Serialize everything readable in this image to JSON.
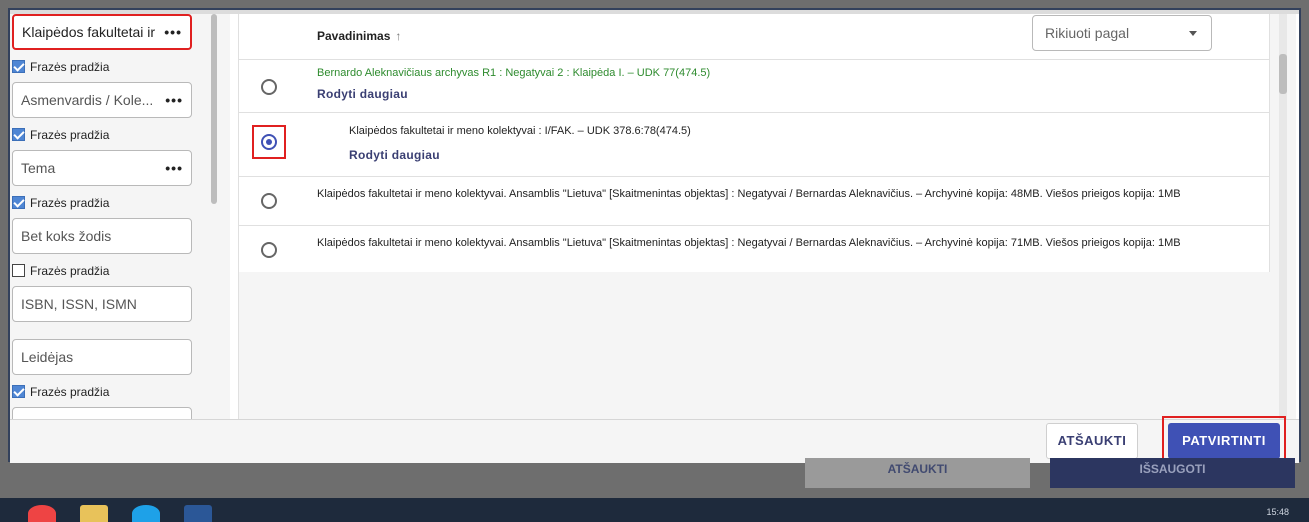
{
  "filters": [
    {
      "label": "Klaipėdos fakultetai ir",
      "active": true,
      "phrase_start": true
    },
    {
      "label": "Asmenvardis / Kole...",
      "phrase_start": true
    },
    {
      "label": "Tema",
      "phrase_start": true
    },
    {
      "label": "Bet koks žodis",
      "phrase_start": false
    },
    {
      "label": "ISBN, ISSN, ISMN"
    },
    {
      "label": "Leidėjas",
      "phrase_start": true
    }
  ],
  "phrase_start_label": "Frazės pradžia",
  "more_icon": "more-dots-icon",
  "table": {
    "column_title": "Pavadinimas",
    "sort_arrow": "↑",
    "sort_placeholder": "Rikiuoti pagal",
    "more_label": "Rodyti daugiau",
    "rows": [
      {
        "title": "Bernardo Aleknavičiaus archyvas R1 : Negatyvai 2 : Klaipėda I. – UDK 77(474.5)",
        "selected": false,
        "show_more": true
      },
      {
        "title": "Klaipėdos fakultetai ir meno kolektyvai : I/FAK. – UDK 378.6:78(474.5)",
        "selected": true,
        "show_more": true
      },
      {
        "title": "Klaipėdos fakultetai ir meno kolektyvai. Ansamblis \"Lietuva\" [Skaitmenintas objektas] : Negatyvai / Bernardas Aleknavičius. – Archyvinė kopija: 48MB. Viešos prieigos kopija: 1MB",
        "selected": false
      },
      {
        "title": "Klaipėdos fakultetai ir meno kolektyvai. Ansamblis \"Lietuva\" [Skaitmenintas objektas] : Negatyvai / Bernardas Aleknavičius. – Archyvinė kopija: 71MB. Viešos prieigos kopija: 1MB",
        "selected": false
      }
    ]
  },
  "footer": {
    "cancel": "ATŠAUKTI",
    "confirm": "PATVIRTINTI"
  },
  "background": {
    "cancel": "ATŠAUKTI",
    "save": "IŠSAUGOTI"
  },
  "taskbar": {
    "clock": "15:48"
  },
  "colors": {
    "primary": "#3f51b5",
    "highlight": "#e02020",
    "green_title": "#2e8b2e"
  }
}
